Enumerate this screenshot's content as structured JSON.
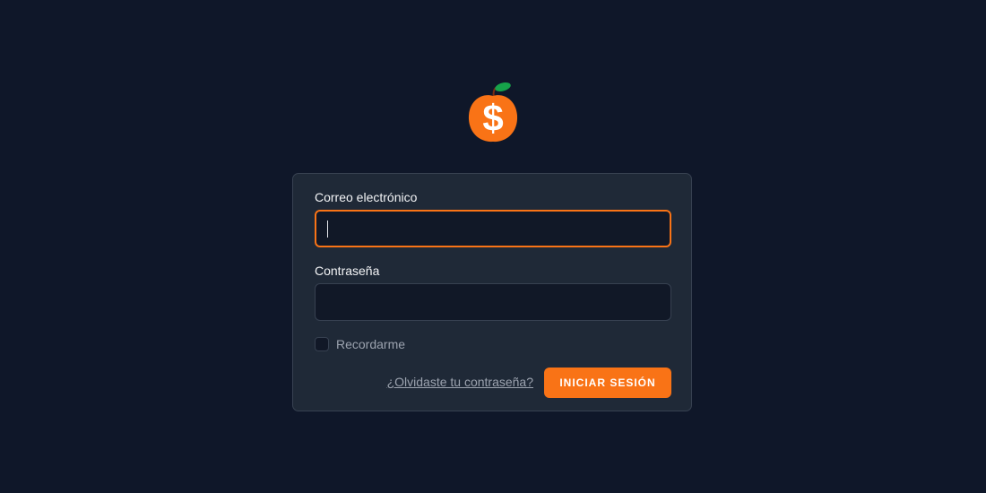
{
  "logo": {
    "icon": "orange-dollar-icon",
    "symbol": "$",
    "colors": {
      "fruit": "#f97316",
      "leaf": "#16a34a",
      "symbol": "#ffffff"
    }
  },
  "form": {
    "email_label": "Correo electrónico",
    "email_value": "",
    "password_label": "Contraseña",
    "password_value": "",
    "remember_label": "Recordarme",
    "remember_checked": false,
    "forgot_link": "¿Olvidaste tu contraseña?",
    "submit_label": "INICIAR SESIÓN"
  },
  "colors": {
    "background": "#0f1729",
    "card": "#1f2937",
    "accent": "#f97316",
    "input_bg": "#111827"
  }
}
